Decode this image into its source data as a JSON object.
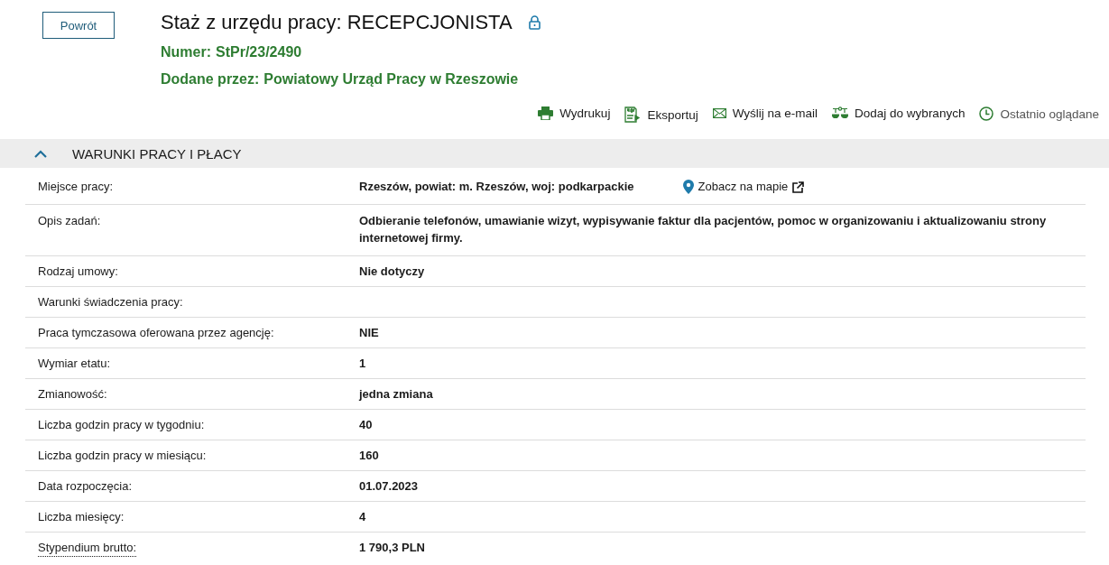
{
  "back_button": "Powrót",
  "title": "Staż z urzędu pracy: RECEPCJONISTA",
  "locked": true,
  "meta": [
    {
      "label": "Numer:",
      "value": "StPr/23/2490"
    },
    {
      "label": "Dodane przez:",
      "value": "Powiatowy Urząd Pracy w Rzeszowie"
    }
  ],
  "toolbar": [
    {
      "kind": "print",
      "label": "Wydrukuj",
      "muted": false
    },
    {
      "kind": "export",
      "label": "Eksportuj",
      "muted": false
    },
    {
      "kind": "email",
      "label": "Wyślij na e-mail",
      "muted": false
    },
    {
      "kind": "favorite",
      "label": "Dodaj do wybranych",
      "muted": false
    },
    {
      "kind": "recent",
      "label": "Ostatnio oglądane",
      "muted": true
    }
  ],
  "section": {
    "title": "WARUNKI PRACY I PŁACY",
    "expanded": true,
    "rows": [
      {
        "label": "Miejsce pracy:",
        "value": "Rzeszów, powiat: m. Rzeszów, woj: podkarpackie",
        "map_link": "Zobacz na mapie",
        "tooltip": false
      },
      {
        "label": "Opis zadań:",
        "value": "Odbieranie telefonów, umawianie wizyt, wypisywanie faktur dla pacjentów, pomoc w organizowaniu i aktualizowaniu strony internetowej firmy.",
        "tooltip": false
      },
      {
        "label": "Rodzaj umowy:",
        "value": "Nie dotyczy",
        "tooltip": false
      },
      {
        "label": "Warunki świadczenia pracy:",
        "tooltip": false
      },
      {
        "label": "Praca tymczasowa oferowana przez agencję:",
        "value": "NIE",
        "tooltip": false
      },
      {
        "label": "Wymiar etatu:",
        "value": "1",
        "tooltip": false
      },
      {
        "label": "Zmianowość:",
        "value": "jedna zmiana",
        "tooltip": false
      },
      {
        "label": "Liczba godzin pracy w tygodniu:",
        "value": "40",
        "tooltip": false
      },
      {
        "label": "Liczba godzin pracy w miesiącu:",
        "value": "160",
        "tooltip": false
      },
      {
        "label": "Data rozpoczęcia:",
        "value": "01.07.2023",
        "tooltip": false
      },
      {
        "label": "Liczba miesięcy:",
        "value": "4",
        "tooltip": false
      },
      {
        "label": "Stypendium brutto:",
        "value": "1 790,3 PLN",
        "tooltip": true
      }
    ]
  }
}
